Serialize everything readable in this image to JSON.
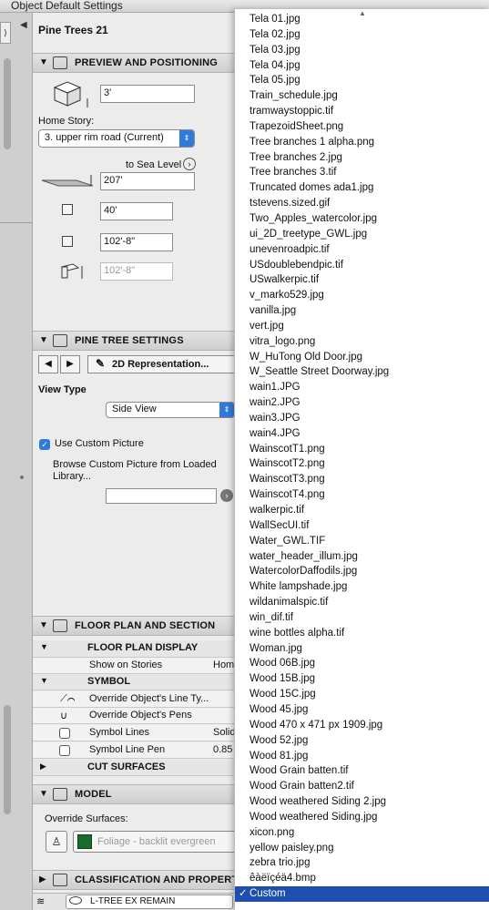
{
  "window": {
    "title": "Object Default Settings"
  },
  "object": {
    "name": "Pine Trees 21"
  },
  "preview_section": {
    "title": "PREVIEW AND POSITIONING",
    "height_value": "3'",
    "home_story_label": "Home Story:",
    "home_story_value": "3. upper rim road (Current)",
    "sea_level_label": "to Sea Level",
    "sea_level_value": "207'",
    "width_value": "40'",
    "depth_value": "102'-8\"",
    "height3_value": "102'-8\""
  },
  "pine_section": {
    "title": "PINE TREE SETTINGS",
    "representation_label": "2D Representation...",
    "view_type_label": "View Type",
    "view_type_value": "Side View",
    "use_custom_picture_label": "Use Custom Picture",
    "browse_label": "Browse Custom Picture from Loaded Library..."
  },
  "floor_plan_section": {
    "title": "FLOOR PLAN AND SECTION",
    "floor_plan_display": "FLOOR PLAN DISPLAY",
    "show_on_stories_label": "Show on Stories",
    "show_on_stories_value": "Hom",
    "symbol_label": "SYMBOL",
    "override_line_types": "Override Object's Line Ty...",
    "override_pens": "Override Object's Pens",
    "symbol_lines": "Symbol Lines",
    "symbol_lines_value": "Solid",
    "symbol_line_pen": "Symbol Line Pen",
    "symbol_line_pen_value": "0.85",
    "cut_surfaces": "CUT SURFACES"
  },
  "model_section": {
    "title": "MODEL",
    "override_surfaces_label": "Override Surfaces:",
    "surface_value": "Foliage - backlit evergreen"
  },
  "classification_section": {
    "title": "CLASSIFICATION AND PROPERTIE"
  },
  "bottom": {
    "layer_value": "L-TREE EX REMAIN"
  },
  "dropdown": {
    "items": [
      "Tela 01.jpg",
      "Tela 02.jpg",
      "Tela 03.jpg",
      "Tela 04.jpg",
      "Tela 05.jpg",
      "Train_schedule.jpg",
      "tramwaystoppic.tif",
      "TrapezoidSheet.png",
      "Tree branches 1 alpha.png",
      "Tree branches 2.jpg",
      "Tree branches 3.tif",
      "Truncated domes ada1.jpg",
      "tstevens.sized.gif",
      "Two_Apples_watercolor.jpg",
      "ui_2D_treetype_GWL.jpg",
      "unevenroadpic.tif",
      "USdoublebendpic.tif",
      "USwalkerpic.tif",
      "v_marko529.jpg",
      "vanilla.jpg",
      "vert.jpg",
      "vitra_logo.png",
      "W_HuTong Old Door.jpg",
      "W_Seattle Street Doorway.jpg",
      "wain1.JPG",
      "wain2.JPG",
      "wain3.JPG",
      "wain4.JPG",
      "WainscotT1.png",
      "WainscotT2.png",
      "WainscotT3.png",
      "WainscotT4.png",
      "walkerpic.tif",
      "WallSecUI.tif",
      "Water_GWL.TIF",
      "water_header_illum.jpg",
      "WatercolorDaffodils.jpg",
      "White lampshade.jpg",
      "wildanimalspic.tif",
      "win_dif.tif",
      "wine bottles alpha.tif",
      "Woman.jpg",
      "Wood 06B.jpg",
      "Wood 15B.jpg",
      "Wood 15C.jpg",
      "Wood 45.jpg",
      "Wood 470 x 471 px 1909.jpg",
      "Wood 52.jpg",
      "Wood 81.jpg",
      "Wood Grain batten.tif",
      "Wood Grain batten2.tif",
      "Wood weathered Siding 2.jpg",
      "Wood weathered Siding.jpg",
      "xicon.png",
      "yellow paisley.png",
      "zebra trio.jpg",
      "êàëïçéä4.bmp"
    ],
    "selected": "Custom",
    "checkmark": "✓"
  }
}
